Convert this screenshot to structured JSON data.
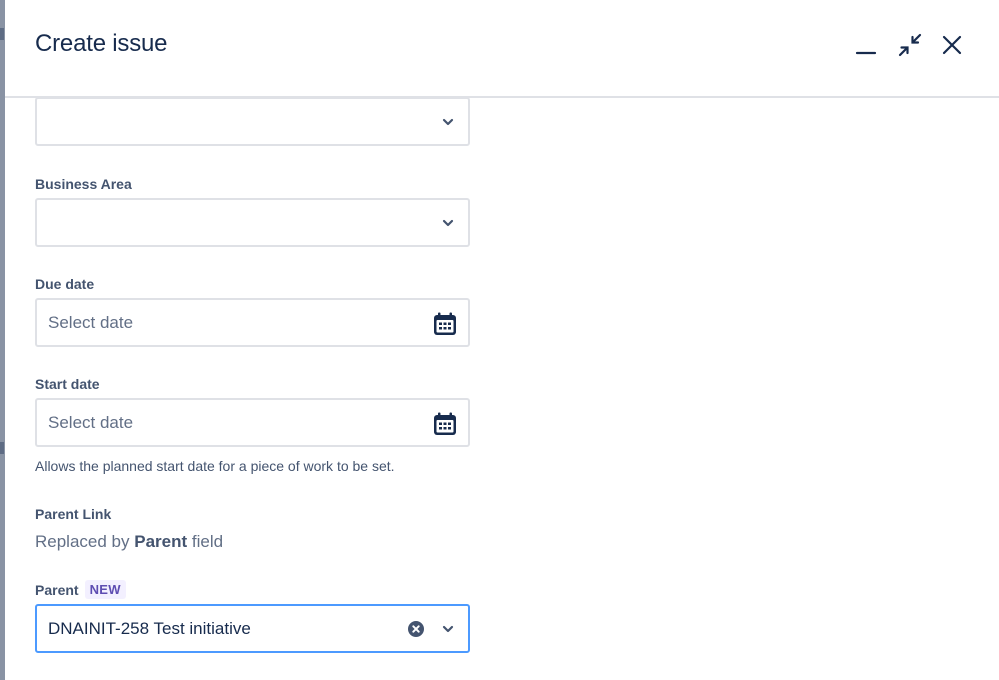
{
  "modal": {
    "title": "Create issue",
    "controls": {
      "minimize_icon": "minimize-icon",
      "collapse_icon": "collapse-arrows-icon",
      "close_icon": "close-icon"
    }
  },
  "form": {
    "top_select": {
      "value": "",
      "icon": "chevron-down-icon"
    },
    "business_area": {
      "label": "Business Area",
      "value": "",
      "icon": "chevron-down-icon"
    },
    "due_date": {
      "label": "Due date",
      "placeholder": "Select date",
      "icon": "calendar-icon"
    },
    "start_date": {
      "label": "Start date",
      "placeholder": "Select date",
      "icon": "calendar-icon",
      "help": "Allows the planned start date for a piece of work to be set."
    },
    "parent_link": {
      "label": "Parent Link",
      "text_prefix": "Replaced by ",
      "text_bold": "Parent",
      "text_suffix": " field"
    },
    "parent": {
      "label": "Parent",
      "badge": "NEW",
      "value": "DNAINIT-258 Test initiative",
      "clear_icon": "clear-icon",
      "icon": "chevron-down-icon"
    }
  },
  "colors": {
    "focus_border": "#4c9aff",
    "badge_bg": "#f3f0ff",
    "badge_text": "#5e4db2",
    "title_text": "#172b4d"
  }
}
